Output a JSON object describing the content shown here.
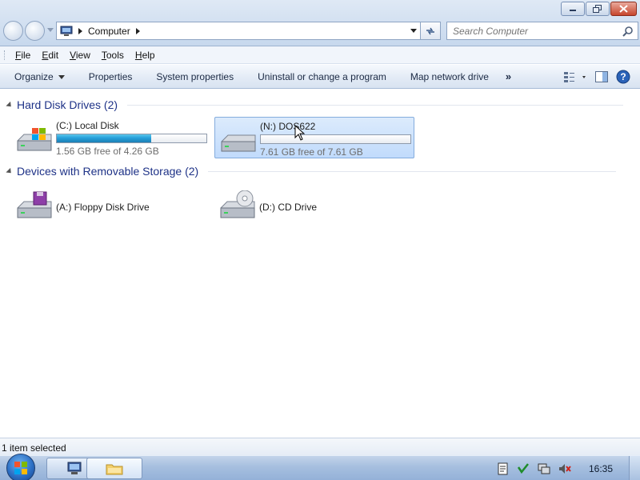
{
  "window": {
    "controls": {
      "minimize_icon": "minimize-icon",
      "restore_icon": "restore-icon",
      "close_icon": "close-icon"
    }
  },
  "address": {
    "location": "Computer",
    "search_placeholder": "Search Computer"
  },
  "menu": [
    {
      "label": "File",
      "accel": "F",
      "rest": "ile"
    },
    {
      "label": "Edit",
      "accel": "E",
      "rest": "dit"
    },
    {
      "label": "View",
      "accel": "V",
      "rest": "iew"
    },
    {
      "label": "Tools",
      "accel": "T",
      "rest": "ools"
    },
    {
      "label": "Help",
      "accel": "H",
      "rest": "elp"
    }
  ],
  "toolbar": {
    "organize": "Organize",
    "properties": "Properties",
    "system_properties": "System properties",
    "uninstall": "Uninstall or change a program",
    "map_drive": "Map network drive",
    "more": "»"
  },
  "groups": {
    "hdd": {
      "title": "Hard Disk Drives (2)",
      "drives": [
        {
          "name": "(C:) Local Disk",
          "free": "1.56 GB free of 4.26 GB",
          "used_fraction": 0.63,
          "icon": "windows-drive-icon",
          "selected": false
        },
        {
          "name": "(N:) DOS622",
          "free": "7.61 GB free of 7.61 GB",
          "used_fraction": 0.0,
          "icon": "hard-drive-icon",
          "selected": true
        }
      ]
    },
    "removable": {
      "title": "Devices with Removable Storage (2)",
      "devices": [
        {
          "name": "(A:) Floppy Disk Drive",
          "icon": "floppy-drive-icon"
        },
        {
          "name": "(D:) CD Drive",
          "icon": "cd-drive-icon"
        }
      ]
    }
  },
  "status": {
    "text": "1 item selected"
  },
  "taskbar": {
    "clock": "16:35"
  },
  "colors": {
    "accent": "#26a0da",
    "selection": "#c1dbfc",
    "group_title": "#1e3287"
  }
}
